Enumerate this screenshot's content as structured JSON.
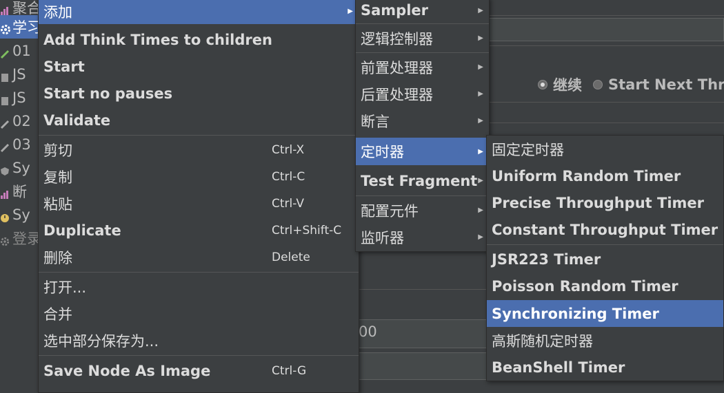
{
  "background": {
    "tree_items": [
      {
        "label": "聚合",
        "icon": "chart-icon"
      },
      {
        "label": "学习",
        "icon": "gear-icon",
        "selected": true
      },
      {
        "label": "01",
        "icon": "pencil-icon"
      },
      {
        "label": "JS",
        "icon": "script-icon"
      },
      {
        "label": "JS",
        "icon": "script-icon"
      },
      {
        "label": "02",
        "icon": "pencil-icon"
      },
      {
        "label": "03",
        "icon": "pencil-icon"
      },
      {
        "label": "Sy",
        "icon": "shield-icon"
      },
      {
        "label": "断",
        "icon": "chart-icon"
      },
      {
        "label": "Sy",
        "icon": "timer-icon"
      },
      {
        "label": "登录",
        "icon": "gear-icon"
      }
    ],
    "radio_continue": "继续",
    "radio_next": "Start Next Thre",
    "partial_value": "00"
  },
  "main_menu": {
    "items": [
      {
        "label": "添加",
        "selected": true,
        "submenu": true
      },
      {
        "label": "Add Think Times to children"
      },
      {
        "label": "Start"
      },
      {
        "label": "Start no pauses"
      },
      {
        "label": "Validate"
      },
      {
        "label": "剪切",
        "shortcut": "Ctrl-X"
      },
      {
        "label": "复制",
        "shortcut": "Ctrl-C"
      },
      {
        "label": "粘贴",
        "shortcut": "Ctrl-V"
      },
      {
        "label": "Duplicate",
        "shortcut": "Ctrl+Shift-C"
      },
      {
        "label": "删除",
        "shortcut": "Delete"
      },
      {
        "label": "打开..."
      },
      {
        "label": "合并"
      },
      {
        "label": "选中部分保存为..."
      },
      {
        "label": "Save Node As Image",
        "shortcut": "Ctrl-G"
      }
    ]
  },
  "add_menu": {
    "items": [
      {
        "label": "Sampler",
        "submenu": true
      },
      {
        "label": "逻辑控制器",
        "submenu": true
      },
      {
        "label": "前置处理器",
        "submenu": true
      },
      {
        "label": "后置处理器",
        "submenu": true
      },
      {
        "label": "断言",
        "submenu": true
      },
      {
        "label": "定时器",
        "submenu": true,
        "selected": true
      },
      {
        "label": "Test Fragment",
        "submenu": true
      },
      {
        "label": "配置元件",
        "submenu": true
      },
      {
        "label": "监听器",
        "submenu": true
      }
    ]
  },
  "timer_menu": {
    "items": [
      {
        "label": "固定定时器"
      },
      {
        "label": "Uniform Random Timer"
      },
      {
        "label": "Precise Throughput Timer"
      },
      {
        "label": "Constant Throughput Timer"
      },
      {
        "label": "JSR223 Timer"
      },
      {
        "label": "Poisson Random Timer"
      },
      {
        "label": "Synchronizing Timer",
        "selected": true
      },
      {
        "label": "高斯随机定时器"
      },
      {
        "label": "BeanShell Timer"
      }
    ]
  },
  "colors": {
    "background": "#3c3f41",
    "selection": "#4b6eaf",
    "text": "#dcdcdc"
  }
}
